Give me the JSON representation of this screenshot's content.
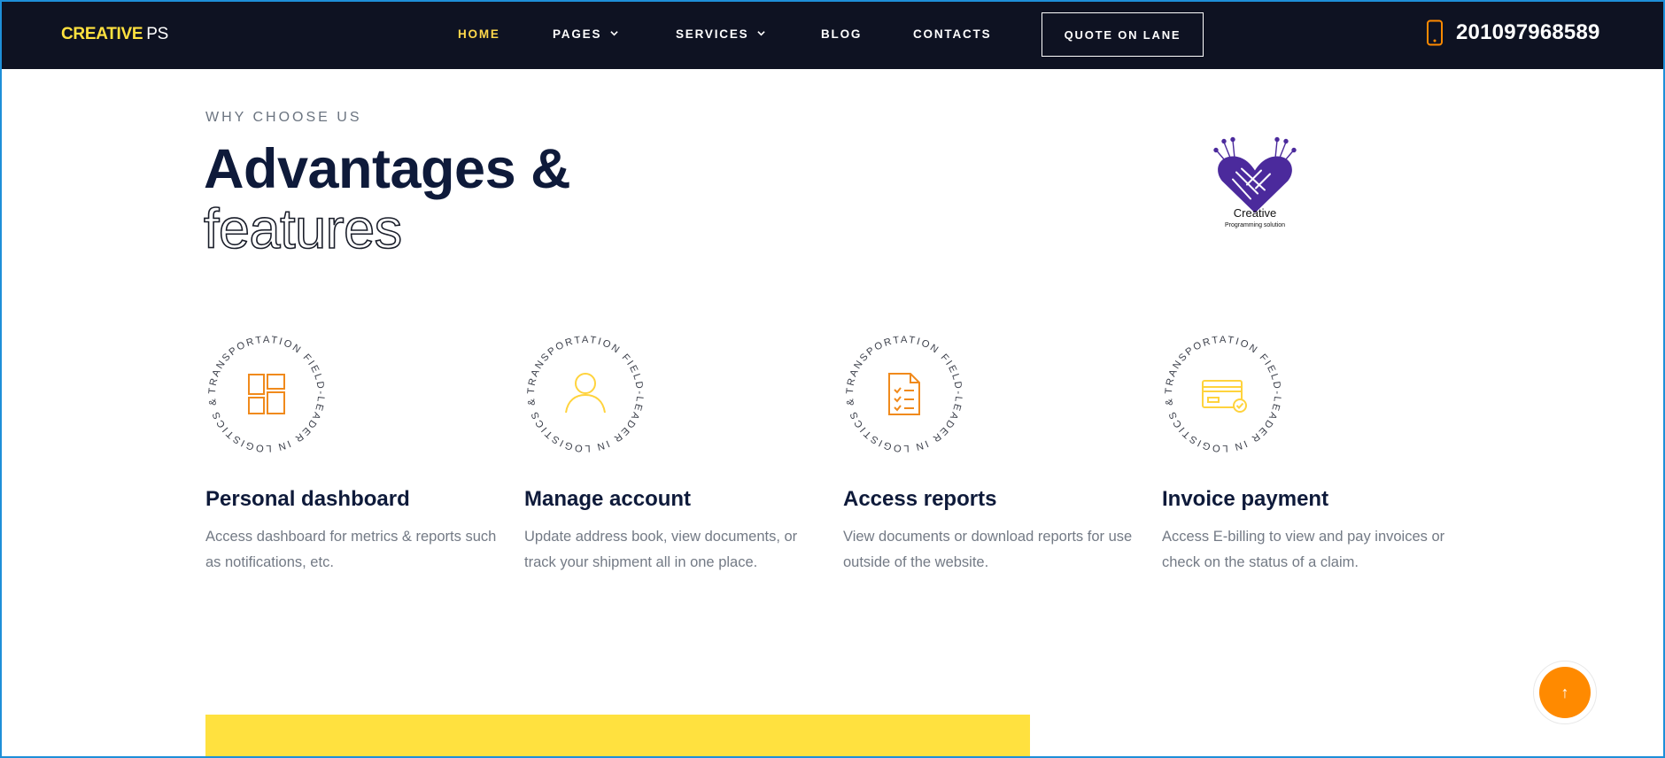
{
  "nav": {
    "logo_part1": "CREATIVE",
    "logo_part2": "PS",
    "items": [
      {
        "label": "HOME",
        "active": true
      },
      {
        "label": "PAGES",
        "dropdown": true
      },
      {
        "label": "SERVICES",
        "dropdown": true
      },
      {
        "label": "BLOG"
      },
      {
        "label": "CONTACTS"
      }
    ],
    "quote_label": "QUOTE ON LANE",
    "phone_icon": "phone-icon",
    "phone_number": "201097968589"
  },
  "hero": {
    "eyebrow": "WHY CHOOSE US",
    "title_line1": "Advantages &",
    "title_line2": "features"
  },
  "brand": {
    "icon": "handshake-heart-logo",
    "name": "Creative",
    "tagline": "Programming solution"
  },
  "features": {
    "ring_text": "TRANSPORTATION FIELD-LEADER IN LOGISTICS & ",
    "items": [
      {
        "icon": "dashboard-icon",
        "title": "Personal dashboard",
        "desc": "Access dashboard for metrics & reports such as notifications, etc."
      },
      {
        "icon": "user-icon",
        "title": "Manage account",
        "desc": "Update address book, view documents, or track your shipment all in one place."
      },
      {
        "icon": "report-icon",
        "title": "Access reports",
        "desc": "View documents or download reports for use outside of the website."
      },
      {
        "icon": "credit-card-icon",
        "title": "Invoice payment",
        "desc": "Access E-billing to view and pay invoices or check on the status of a claim."
      }
    ]
  },
  "scroll_top": {
    "icon": "arrow-up-icon",
    "glyph": "↑"
  },
  "colors": {
    "nav_bg": "#0e1222",
    "accent_yellow": "#ffe13f",
    "accent_orange": "#ff8a00",
    "heading": "#0e1a3a",
    "body_text": "#737a85",
    "brand_purple": "#4b2a9c"
  }
}
